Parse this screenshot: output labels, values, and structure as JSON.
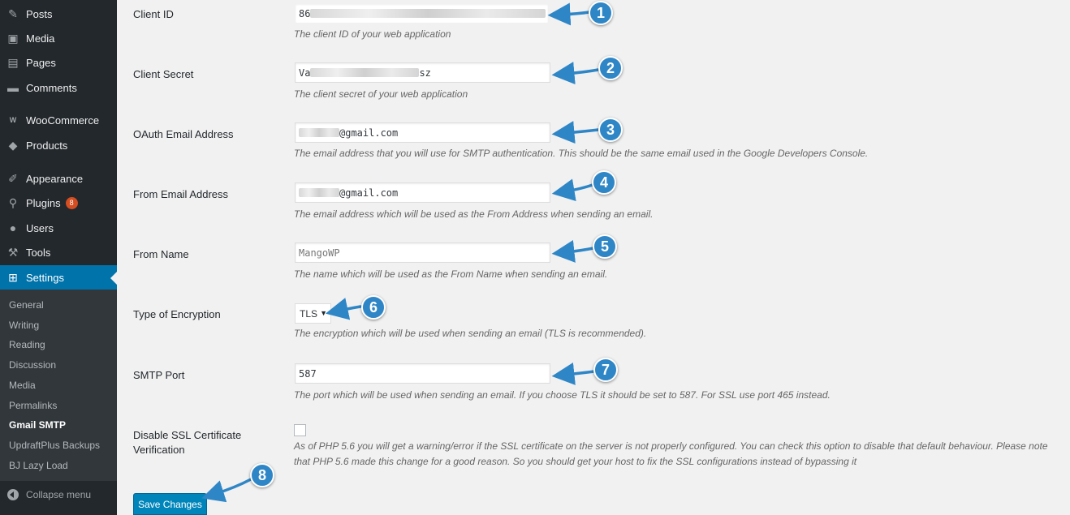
{
  "sidebar": {
    "items": [
      {
        "label": "Posts",
        "icon": "pin-icon",
        "glyph": "✎"
      },
      {
        "label": "Media",
        "icon": "media-icon",
        "glyph": "▣"
      },
      {
        "label": "Pages",
        "icon": "pages-icon",
        "glyph": "▤"
      },
      {
        "label": "Comments",
        "icon": "comment-icon",
        "glyph": "▬"
      },
      {
        "label": "WooCommerce",
        "icon": "woo-icon",
        "glyph": "W"
      },
      {
        "label": "Products",
        "icon": "products-icon",
        "glyph": "◆"
      },
      {
        "label": "Appearance",
        "icon": "brush-icon",
        "glyph": "✐"
      },
      {
        "label": "Plugins",
        "icon": "plugin-icon",
        "glyph": "⚲",
        "badge": "8"
      },
      {
        "label": "Users",
        "icon": "user-icon",
        "glyph": "●"
      },
      {
        "label": "Tools",
        "icon": "wrench-icon",
        "glyph": "⚒"
      },
      {
        "label": "Settings",
        "icon": "settings-icon",
        "glyph": "⊞",
        "active": true
      }
    ],
    "submenu": [
      "General",
      "Writing",
      "Reading",
      "Discussion",
      "Media",
      "Permalinks",
      "Gmail SMTP",
      "UpdraftPlus Backups",
      "BJ Lazy Load"
    ],
    "current_submenu": "Gmail SMTP",
    "collapse_label": "Collapse menu"
  },
  "form": {
    "client_id": {
      "label": "Client ID",
      "value": "86",
      "desc": "The client ID of your web application"
    },
    "client_secret": {
      "label": "Client Secret",
      "value_start": "Va",
      "value_end": "sz",
      "desc": "The client secret of your web application"
    },
    "oauth_email": {
      "label": "OAuth Email Address",
      "value": "@gmail.com",
      "desc": "The email address that you will use for SMTP authentication. This should be the same email used in the Google Developers Console."
    },
    "from_email": {
      "label": "From Email Address",
      "value": "@gmail.com",
      "desc": "The email address which will be used as the From Address when sending an email."
    },
    "from_name": {
      "label": "From Name",
      "value": "MangoWP",
      "desc": "The name which will be used as the From Name when sending an email."
    },
    "encryption": {
      "label": "Type of Encryption",
      "value": "TLS",
      "desc": "The encryption which will be used when sending an email (TLS is recommended)."
    },
    "smtp_port": {
      "label": "SMTP Port",
      "value": "587",
      "desc": "The port which will be used when sending an email. If you choose TLS it should be set to 587. For SSL use port 465 instead."
    },
    "disable_ssl": {
      "label_line1": "Disable SSL Certificate",
      "label_line2": "Verification",
      "checked": false,
      "desc_line1": "As of PHP 5.6 you will get a warning/error if the SSL certificate on the server is not properly configured. You can check this option to disable that default behaviour. Please note",
      "desc_line2": "that PHP 5.6 made this change for a good reason. So you should get your host to fix the SSL configurations instead of bypassing it"
    },
    "save_label": "Save Changes"
  },
  "callouts": [
    "1",
    "2",
    "3",
    "4",
    "5",
    "6",
    "7",
    "8"
  ],
  "colors": {
    "sidebar": "#23282d",
    "submenu": "#32373c",
    "active": "#0073aa",
    "callout": "#2f86c6",
    "badge": "#d54e21",
    "button": "#0085ba"
  }
}
